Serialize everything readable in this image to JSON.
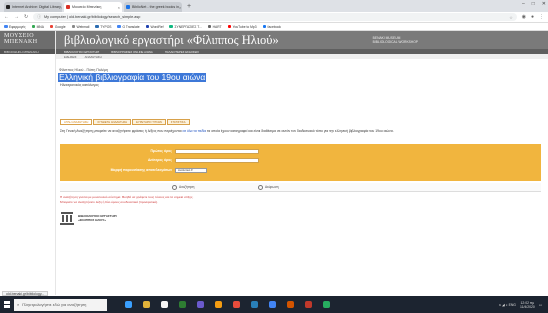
{
  "browser": {
    "tabs": [
      {
        "label": "Internet Archive: Digital Library",
        "color": "#222222",
        "active": false
      },
      {
        "label": "Μουσείο Μπενάκη",
        "color": "#d93025",
        "active": true
      },
      {
        "label": "ΒiblioNet - the greek books in",
        "color": "#1a73e8",
        "active": false
      }
    ],
    "new_tab": "+",
    "window_controls": [
      "–",
      "□",
      "✕"
    ],
    "url": "My computer | old.benaki.gr/bibliology/search_simple.asp",
    "bookmarks": [
      {
        "label": "Εφαρμογές",
        "color": "#4285f4"
      },
      {
        "label": "MNA",
        "color": "#34a853"
      },
      {
        "label": "Google",
        "color": "#ea4335"
      },
      {
        "label": "Webmail",
        "color": "#888888"
      },
      {
        "label": "TYPOS",
        "color": "#2b6cb0"
      },
      {
        "label": "G Translate",
        "color": "#4285f4"
      },
      {
        "label": "WordRef",
        "color": "#1e40af"
      },
      {
        "label": "ΣΥΝΕΡΓΑΣΙΕΣ Τ...",
        "color": "#10b981"
      },
      {
        "label": "HART",
        "color": "#666666"
      },
      {
        "label": "YouTube to Mp3",
        "color": "#ff0000"
      },
      {
        "label": "facebook",
        "color": "#1877f2"
      }
    ]
  },
  "site": {
    "museum_logo": "ΜΟΥΣΕΙΟ\nΜΠΕΝΑΚΗ",
    "left_sub": "ΒΙΒΛΙΟΘΗΚΗ ΜΠΕΝΑΚΗ",
    "brand_title": "βιβλιολογικό εργαστήρι «Φίλιππος Ηλιού»",
    "museum_label": "BENAKI MUSEUM\nBIBLIOLOGICAL WORKSHOP",
    "nav": [
      "ΒΙΒΛΙΟΛΟΓΙΚΟ ΕΡΓΑΣΤΗΡΙ",
      "ΒΙΒΛΙΟΓΡΑΦΙΕΣ ONLINE ΑΙΩΝΑ",
      "ΠΑΛΑΙΟΤΕΡΕΣ ΕΚΔΟΣΕΙΣ"
    ],
    "subnav": [
      "ΕΙΔΗΣΕΙΣ",
      "ΑΝΑΖΗΤΗΣΗ"
    ],
    "breadcrumb": "Φίλιππος Ηλιού - Πόπη Πολέμη",
    "page_title": "Ελληνική βιβλιογραφία του 19ου αιώνα",
    "page_subtitle": "Ηλεκτρονικός κατάλογος",
    "search_tabs": [
      {
        "label": "ΑΠΛΗ ΑΝΑΖΗΤΗΣΗ",
        "active": true
      },
      {
        "label": "ΣΥΝΘΕΤΗ ΑΝΑΖΗΤΗΣΗ",
        "active": false
      },
      {
        "label": "ΕΥΡΕΤΗΡΙΟ ΤΙΤΛΩΝ",
        "active": false
      },
      {
        "label": "ΣΤΑΤΙΣΤΙΚΑ",
        "active": false
      }
    ],
    "intro_before": "Στη Γενική Αναζήτηση μπορείτε να αναζητήσετε φράσεις ή λέξεις που περιέχονται ",
    "intro_link": "σε όλα τα πεδία",
    "intro_after": " τα οποία έχουν καταγραφεί και είναι διαθέσιμα σε αυτόν τον διαδικτυακό τόπο για την ελληνική βιβλιογραφία του 19ου αιώνα.",
    "form": {
      "first_term_label": "Πρώτος όρος",
      "second_term_label": "Δεύτερος όρος",
      "sort_label": "Μορφή παρουσίασης αποτελεσμάτων",
      "sort_value": "Αναλυτικό ▾",
      "search_button": "Αναζήτηση",
      "clear_button": "Ακύρωση"
    },
    "note_line1": "Η αναζήτηση γίνεται με μονοτονικό σύστημα. Βοηθά να γράφετε τους τόνους και τα σημεία στίξης.",
    "note_line2": "Μπορείτε να αναζητήσετε λέξη ή δύο όρους συνδυαστικά (προαιρετικό).",
    "footer_title": "ΒΙΒΛΙΟΛΟΓΙΚΟ ΕΡΓΑΣΤΗΡΙ",
    "footer_sub": "«ΦΙΛΙΠΠΟΣ ΗΛΙΟΥ»"
  },
  "statusbar": "old.benaki.gr/bibliology...",
  "taskbar": {
    "search_placeholder": "Πληκτρολογήστε εδώ για αναζήτηση",
    "apps": [
      "#3aa0ff",
      "#e2b33a",
      "#f5f5f5",
      "#2e7d32",
      "#6a5acd",
      "#f39c12",
      "#e74c3c",
      "#2980b9",
      "#4285f4",
      "#d35400",
      "#c0392b",
      "#27ae60"
    ],
    "time": "12:02 πμ",
    "date": "11/4/2020",
    "tray": "∧ ◢ ◖ ENG"
  }
}
